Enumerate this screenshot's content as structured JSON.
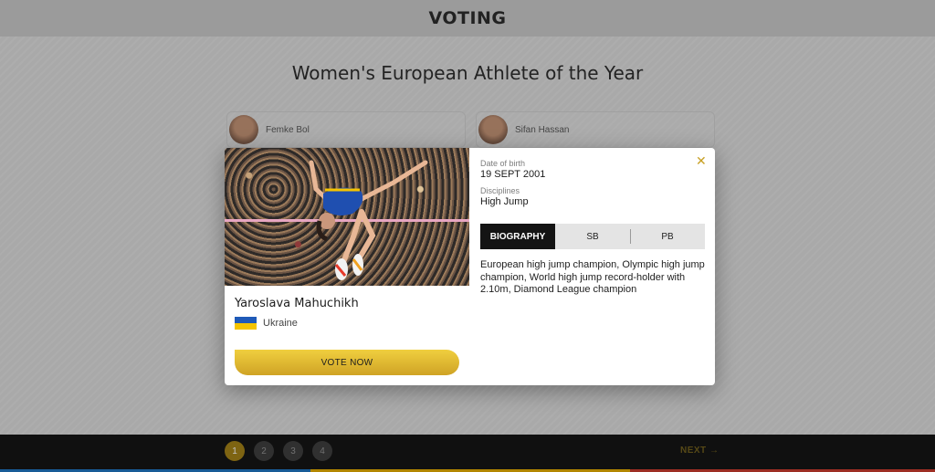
{
  "header": {
    "title": "VOTING"
  },
  "page": {
    "title": "Women's European Athlete of the Year",
    "candidates": [
      {
        "name": "Femke Bol"
      },
      {
        "name": "Sifan Hassan"
      }
    ]
  },
  "pagination": {
    "pages": [
      "1",
      "2",
      "3",
      "4"
    ],
    "current": "1",
    "next_label": "NEXT →"
  },
  "modal": {
    "athlete_name": "Yaroslava Mahuchikh",
    "country": "Ukraine",
    "flag_colors": [
      "#1f5ab8",
      "#f5c400"
    ],
    "vote_label": "VOTE NOW",
    "dob_label": "Date of birth",
    "dob_value": "19 SEPT 2001",
    "disciplines_label": "Disciplines",
    "disciplines_value": "High Jump",
    "tabs": [
      {
        "label": "BIOGRAPHY",
        "active": true
      },
      {
        "label": "SB",
        "active": false
      },
      {
        "label": "PB",
        "active": false
      }
    ],
    "biography": "European high jump champion, Olympic high jump champion, World high jump record-holder with 2.10m, Diamond League champion",
    "close_icon": "close-icon"
  }
}
